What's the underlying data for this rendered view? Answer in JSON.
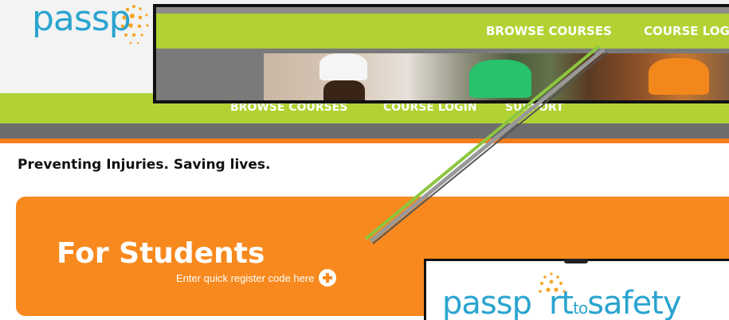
{
  "header": {
    "logo_text": "passp"
  },
  "nav": {
    "items": [
      "BROWSE COURSES",
      "COURSE LOGIN",
      "SUPPORT"
    ]
  },
  "zoom_nav": {
    "items": [
      "BROWSE COURSES",
      "COURSE LOGI"
    ]
  },
  "tagline": "Preventing Injuries. Saving lives.",
  "students": {
    "title": "For Students",
    "subtitle": "Enter quick register code here"
  },
  "popup": {
    "logo_a": "passp",
    "logo_b": "rt",
    "logo_to": "to",
    "logo_c": "safety"
  },
  "colors": {
    "brand_blue": "#2aa4cf",
    "green": "#b2d234",
    "orange": "#f7891e",
    "gray": "#6d6d6d"
  }
}
